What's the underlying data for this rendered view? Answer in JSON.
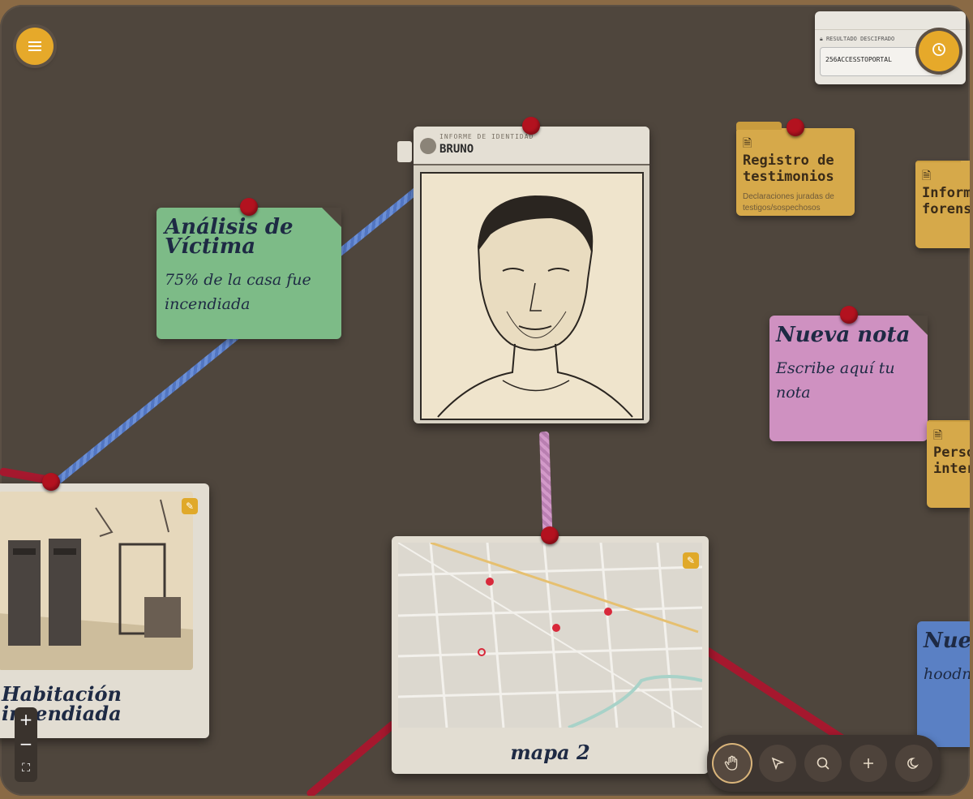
{
  "identity_card": {
    "header_label": "INFORME DE IDENTIDAD",
    "name": "BRUNO"
  },
  "note_victim": {
    "title": "Análisis de Víctima",
    "body": "75% de la casa fue incendiada"
  },
  "note_new": {
    "title": "Nueva nota",
    "body": "Escribe aquí tu nota"
  },
  "note_blue": {
    "title": "Nue",
    "body": "hoodn"
  },
  "folders": {
    "testimonios": {
      "title": "Registro de testimonios",
      "desc": "Declaraciones juradas de testigos/sospechosos"
    },
    "forense": {
      "title": "Inform forens"
    },
    "persona": {
      "title": "Perso inter"
    }
  },
  "photo_card": {
    "caption": "Habitación incendiada"
  },
  "map_card": {
    "caption": "mapa 2"
  },
  "decoded": {
    "label": "RESULTADO DESCIFRADO",
    "value": "256ACCESSTOPORTAL"
  },
  "zoom": {
    "in": "+",
    "out": "−",
    "fit": "⛶"
  },
  "colors": {
    "board": "#4f463d",
    "pin": "#b3121f",
    "accent": "#e6a92a",
    "string_red": "#a5182e",
    "string_blue": "#6b8fd6",
    "string_pink": "#d39ac9"
  },
  "icons": [
    "menu-icon",
    "history-icon",
    "user-icon",
    "lock-icon",
    "document-icon",
    "edit-icon",
    "hand-icon",
    "pointer-icon",
    "search-icon",
    "plus-icon",
    "moon-icon",
    "map-pin-icon"
  ]
}
